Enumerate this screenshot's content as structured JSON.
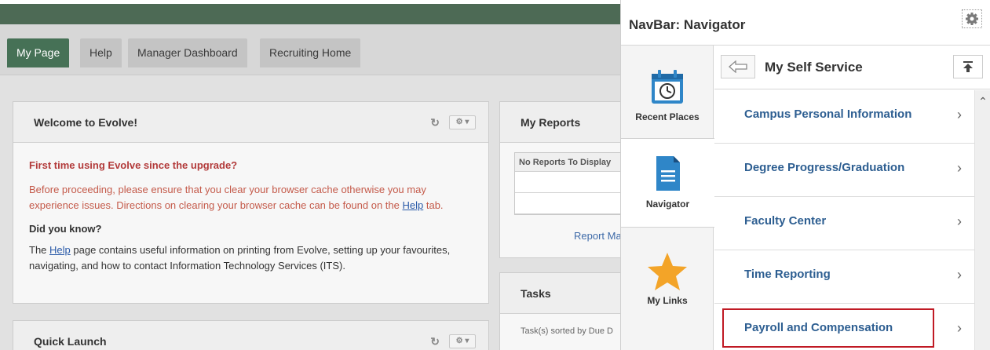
{
  "tabs": [
    "My Page",
    "Help",
    "Manager Dashboard",
    "Recruiting Home"
  ],
  "welcome": {
    "title": "Welcome to Evolve!",
    "heading": "First time using Evolve since the upgrade?",
    "para1_a": "Before proceeding, please ensure that you clear your browser cache otherwise you may experience issues. Directions on clearing your browser cache can be found on the ",
    "para1_link": "Help",
    "para1_b": " tab.",
    "did_you_know": "Did you know?",
    "para2_a": "The ",
    "para2_link": "Help",
    "para2_b": " page contains useful information on printing from Evolve, setting up your favourites, navigating, and how to contact Information Technology Services (ITS)."
  },
  "quick_launch": {
    "title": "Quick Launch"
  },
  "my_reports": {
    "title": "My Reports",
    "table_header": "No Reports To Display",
    "link": "Report Ma"
  },
  "tasks": {
    "title": "Tasks",
    "sub": "Task(s) sorted by Due D"
  },
  "navbar": {
    "title": "NavBar: Navigator",
    "rail": [
      {
        "label": "Recent Places"
      },
      {
        "label": "Navigator"
      },
      {
        "label": "My Links"
      }
    ],
    "section_title": "My Self Service",
    "items": [
      "Campus Personal Information",
      "Degree Progress/Graduation",
      "Faculty Center",
      "Time Reporting",
      "Payroll and Compensation"
    ],
    "highlighted_item": "Payroll and Compensation"
  },
  "colors": {
    "header_green": "#4d6a55",
    "active_tab": "#467156",
    "link_blue": "#2d5e91",
    "highlight_red": "#c01a24",
    "calendar_blue": "#2f86c8",
    "star_orange": "#f3a428"
  }
}
